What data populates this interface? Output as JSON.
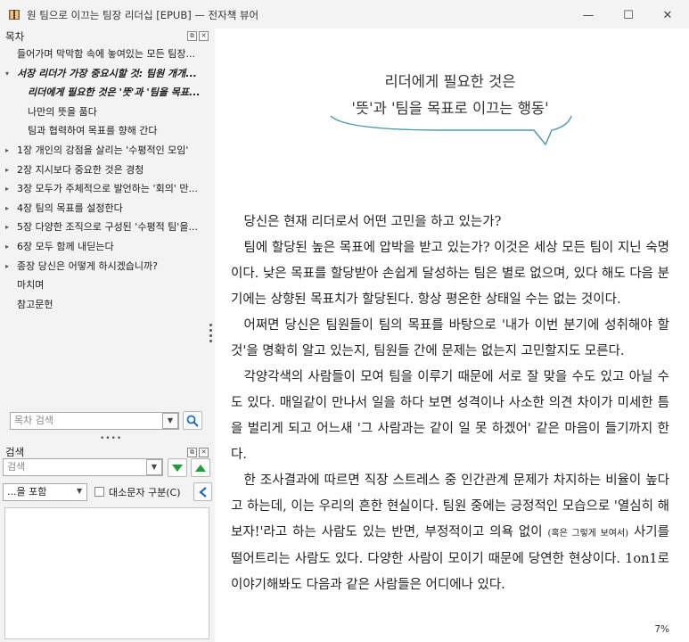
{
  "window": {
    "title": "원 팀으로 이끄는 팀장 리더십 [EPUB] — 전자책 뷰어",
    "minimize_glyph": "—",
    "maximize_glyph": "☐",
    "close_glyph": "✕"
  },
  "toc": {
    "header": "목차",
    "items": [
      {
        "label": "들어가며 막막함 속에 놓여있는 모든 팀장...",
        "level": 0,
        "arrow": "",
        "bold": false
      },
      {
        "label": "서장 리더가 가장 중요시할 것: 팀원 개개...",
        "level": 0,
        "arrow": "▾",
        "bold": true
      },
      {
        "label": "리더에게 필요한 것은 '뜻'과 '팀을 목표...",
        "level": 1,
        "arrow": "",
        "bold": true
      },
      {
        "label": "나만의 뜻을 품다",
        "level": 1,
        "arrow": "",
        "bold": false
      },
      {
        "label": "팀과 협력하여 목표를 향해 간다",
        "level": 1,
        "arrow": "",
        "bold": false
      },
      {
        "label": "1장 개인의 강점을 살리는 '수평적인 모임'",
        "level": 0,
        "arrow": "▸",
        "bold": false
      },
      {
        "label": "2장 지시보다 중요한 것은 경청",
        "level": 0,
        "arrow": "▸",
        "bold": false
      },
      {
        "label": "3장 모두가 주체적으로 발언하는 '회의' 만...",
        "level": 0,
        "arrow": "▸",
        "bold": false
      },
      {
        "label": "4장 팀의 목표를 설정한다",
        "level": 0,
        "arrow": "▸",
        "bold": false
      },
      {
        "label": "5장 다양한 조직으로 구성된 '수평적 팀'을...",
        "level": 0,
        "arrow": "▸",
        "bold": false
      },
      {
        "label": "6장 모두 함께 내딛는다",
        "level": 0,
        "arrow": "▸",
        "bold": false
      },
      {
        "label": "종장 당신은 어떻게 하시겠습니까?",
        "level": 0,
        "arrow": "▸",
        "bold": false
      },
      {
        "label": "마치며",
        "level": 0,
        "arrow": "",
        "bold": false
      },
      {
        "label": "참고문헌",
        "level": 0,
        "arrow": "",
        "bold": false
      }
    ],
    "search_placeholder": "목차 검색"
  },
  "search": {
    "header": "검색",
    "placeholder": "검색",
    "mode_value": "...을 포함",
    "case_label": "대소문자 구분(C)"
  },
  "book": {
    "bubble_line1": "리더에게 필요한 것은",
    "bubble_line2": "'뜻'과 '팀을 목표로 이끄는 행동'",
    "p1": "당신은 현재 리더로서 어떤 고민을 하고 있는가?",
    "p2": "팀에 할당된 높은 목표에 압박을 받고 있는가? 이것은 세상 모든 팀이 지닌 숙명이다. 낮은 목표를 할당받아 손쉽게 달성하는 팀은 별로 없으며, 있다 해도 다음 분기에는 상향된 목표치가 할당된다. 항상 평온한 상태일 수는 없는 것이다.",
    "p3": "어쩌면 당신은 팀원들이 팀의 목표를 바탕으로 '내가 이번 분기에 성취해야 할 것'을 명확히 알고 있는지, 팀원들 간에 문제는 없는지 고민할지도 모른다.",
    "p4": "각양각색의 사람들이 모여 팀을 이루기 때문에 서로 잘 맞을 수도 있고 아닐 수도 있다. 매일같이 만나서 일을 하다 보면 성격이나 사소한 의견 차이가 미세한 틈을 벌리게 되고 어느새 '그 사람과는 같이 일 못 하겠어' 같은 마음이 들기까지 한다.",
    "p5_a": "한 조사결과에 따르면 직장 스트레스 중 인간관계 문제가 차지하는 비율이 높다고 하는데, 이는 우리의 흔한 현실이다. 팀원 중에는 긍정적인 모습으로 '열심히 해 보자!'라고 하는 사람도 있는 반면, 부정적이고 의욕 없이 ",
    "p5_small": "(혹은 그렇게 보여서)",
    "p5_b": " 사기를 떨어트리는 사람도 있다. 다양한 사람이 모이기 때문에 당연한 현상이다. 1on1로 이야기해봐도 다음과 같은 사람들은 어디에나 있다.",
    "progress": "7%"
  }
}
